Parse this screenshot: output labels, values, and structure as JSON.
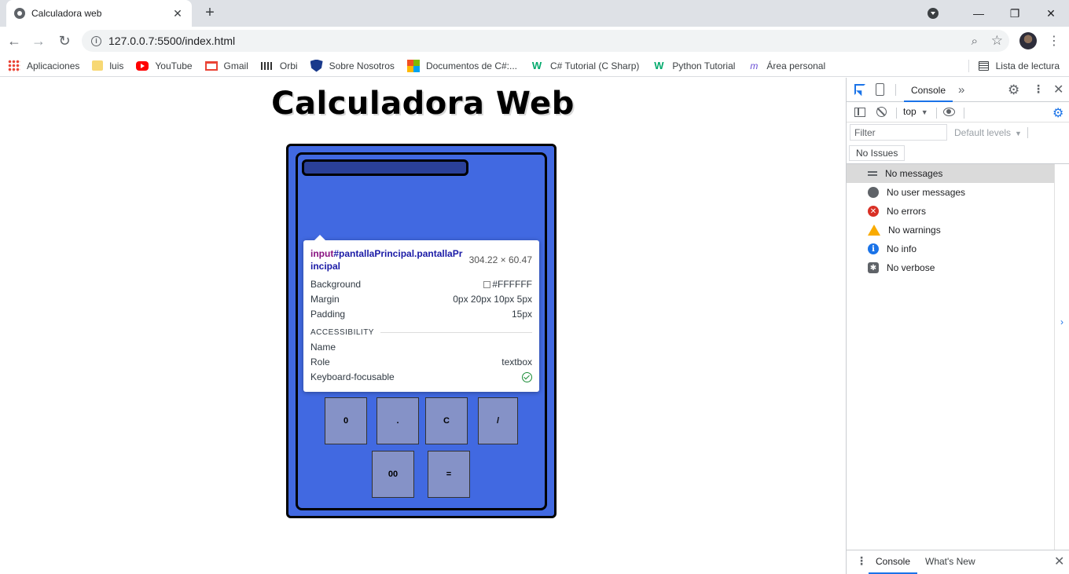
{
  "browser": {
    "tab_title": "Calculadora web",
    "url": "127.0.0.7:5500/index.html"
  },
  "bookmarks": [
    {
      "label": "Aplicaciones",
      "icon": "apps-grid-icon"
    },
    {
      "label": "luis",
      "icon": "folder-icon"
    },
    {
      "label": "YouTube",
      "icon": "youtube-icon"
    },
    {
      "label": "Gmail",
      "icon": "gmail-icon"
    },
    {
      "label": "Orbi",
      "icon": "orbi-icon"
    },
    {
      "label": "Sobre Nosotros",
      "icon": "shield-icon"
    },
    {
      "label": "Documentos de C#:...",
      "icon": "microsoft-icon"
    },
    {
      "label": "C# Tutorial (C Sharp)",
      "icon": "w3schools-icon"
    },
    {
      "label": "Python Tutorial",
      "icon": "w3schools-icon"
    },
    {
      "label": "Área personal",
      "icon": "moodle-icon"
    }
  ],
  "reading_list": "Lista de lectura",
  "page": {
    "title": "Calculadora Web",
    "keys_row": [
      "0",
      ".",
      "C",
      "/"
    ],
    "keys_last": [
      "00",
      "="
    ]
  },
  "tooltip": {
    "tag": "input",
    "selector": "#pantallaPrincipal.pantallaPrincipal",
    "size": "304.22 × 60.47",
    "rows": [
      {
        "label": "Background",
        "value": "#FFFFFF"
      },
      {
        "label": "Margin",
        "value": "0px 20px 10px 5px"
      },
      {
        "label": "Padding",
        "value": "15px"
      }
    ],
    "section": "ACCESSIBILITY",
    "acc_rows": [
      {
        "label": "Name",
        "value": ""
      },
      {
        "label": "Role",
        "value": "textbox"
      },
      {
        "label": "Keyboard-focusable",
        "value": ""
      }
    ]
  },
  "devtools": {
    "tab": "Console",
    "context": "top",
    "filter_placeholder": "Filter",
    "levels": "Default levels",
    "issues": "No Issues",
    "messages": [
      {
        "label": "No messages",
        "icon": "list-icon"
      },
      {
        "label": "No user messages",
        "icon": "user-icon"
      },
      {
        "label": "No errors",
        "icon": "error-icon"
      },
      {
        "label": "No warnings",
        "icon": "warning-icon"
      },
      {
        "label": "No info",
        "icon": "info-icon"
      },
      {
        "label": "No verbose",
        "icon": "verbose-icon"
      }
    ],
    "drawer_tabs": [
      "Console",
      "What's New"
    ]
  },
  "colors": {
    "calc_body": "#4169e1",
    "key": "#8592c7",
    "accent": "#1a73e8"
  }
}
